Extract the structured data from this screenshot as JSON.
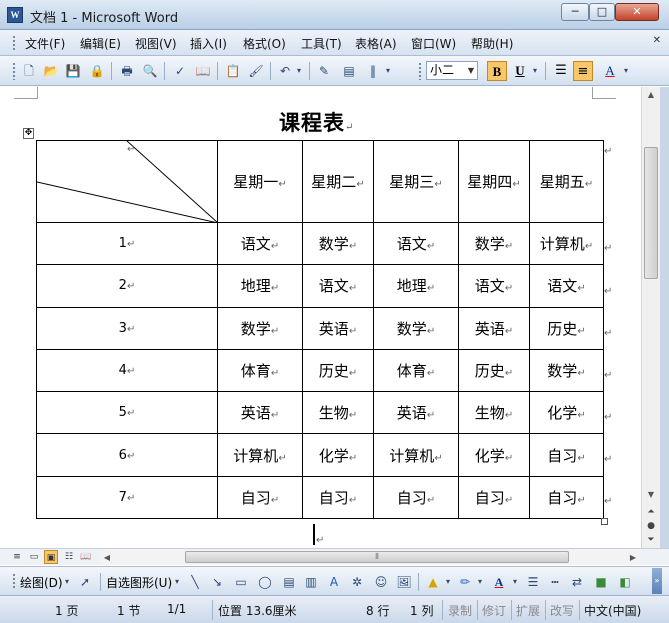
{
  "window": {
    "title": "文档 1 - Microsoft Word",
    "app_icon": "W"
  },
  "menu": [
    "文件(F)",
    "编辑(E)",
    "视图(V)",
    "插入(I)",
    "格式(O)",
    "工具(T)",
    "表格(A)",
    "窗口(W)",
    "帮助(H)"
  ],
  "toolbar": {
    "font_size": "小二",
    "bold": "B",
    "underline": "U",
    "font_color_letter": "A"
  },
  "document": {
    "title": "课程表",
    "paragraph_mark": "↵",
    "header_row": [
      "星期一",
      "星期二",
      "星期三",
      "星期四",
      "星期五"
    ],
    "rows": [
      {
        "num": "1",
        "cells": [
          "语文",
          "数学",
          "语文",
          "数学",
          "计算机"
        ]
      },
      {
        "num": "2",
        "cells": [
          "地理",
          "语文",
          "地理",
          "语文",
          "语文"
        ]
      },
      {
        "num": "3",
        "cells": [
          "数学",
          "英语",
          "数学",
          "英语",
          "历史"
        ]
      },
      {
        "num": "4",
        "cells": [
          "体育",
          "历史",
          "体育",
          "历史",
          "数学"
        ]
      },
      {
        "num": "5",
        "cells": [
          "英语",
          "生物",
          "英语",
          "生物",
          "化学"
        ]
      },
      {
        "num": "6",
        "cells": [
          "计算机",
          "化学",
          "计算机",
          "化学",
          "自习"
        ]
      },
      {
        "num": "7",
        "cells": [
          "自习",
          "自习",
          "自习",
          "自习",
          "自习"
        ]
      }
    ]
  },
  "drawing_toolbar": {
    "draw_label": "绘图(D)",
    "autoshapes_label": "自选图形(U)",
    "font_color_letter": "A"
  },
  "statusbar": {
    "page": "1 页",
    "section": "1 节",
    "page_of": "1/1",
    "position": "位置 13.6厘米",
    "line": "8 行",
    "column": "1 列",
    "rec": "录制",
    "trk": "修订",
    "ext": "扩展",
    "ovr": "改写",
    "language": "中文(中国)"
  }
}
